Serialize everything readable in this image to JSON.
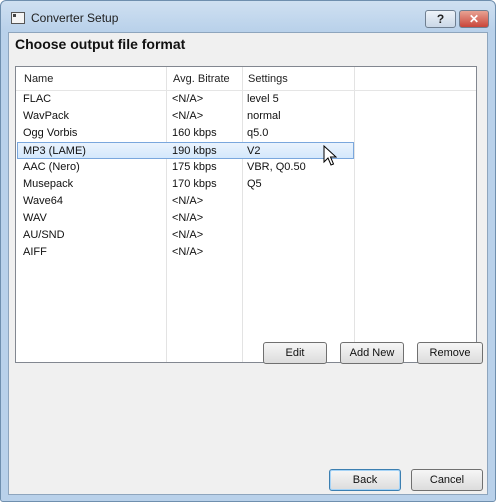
{
  "window": {
    "title": "Converter Setup",
    "help_label": "?",
    "close_label": "✕"
  },
  "heading": "Choose output file format",
  "columns": [
    "Name",
    "Avg. Bitrate",
    "Settings"
  ],
  "rows": [
    {
      "name": "FLAC",
      "bitrate": "<N/A>",
      "settings": "level 5"
    },
    {
      "name": "WavPack",
      "bitrate": "<N/A>",
      "settings": "normal"
    },
    {
      "name": "Ogg Vorbis",
      "bitrate": "160 kbps",
      "settings": "q5.0"
    },
    {
      "name": "MP3 (LAME)",
      "bitrate": "190 kbps",
      "settings": "V2"
    },
    {
      "name": "AAC (Nero)",
      "bitrate": "175 kbps",
      "settings": "VBR, Q0.50"
    },
    {
      "name": "Musepack",
      "bitrate": "170 kbps",
      "settings": "Q5"
    },
    {
      "name": "Wave64",
      "bitrate": "<N/A>",
      "settings": ""
    },
    {
      "name": "WAV",
      "bitrate": "<N/A>",
      "settings": ""
    },
    {
      "name": "AU/SND",
      "bitrate": "<N/A>",
      "settings": ""
    },
    {
      "name": "AIFF",
      "bitrate": "<N/A>",
      "settings": ""
    }
  ],
  "selected_index": 3,
  "buttons": {
    "edit": "Edit",
    "add_new": "Add New",
    "remove": "Remove",
    "back": "Back",
    "cancel": "Cancel"
  }
}
